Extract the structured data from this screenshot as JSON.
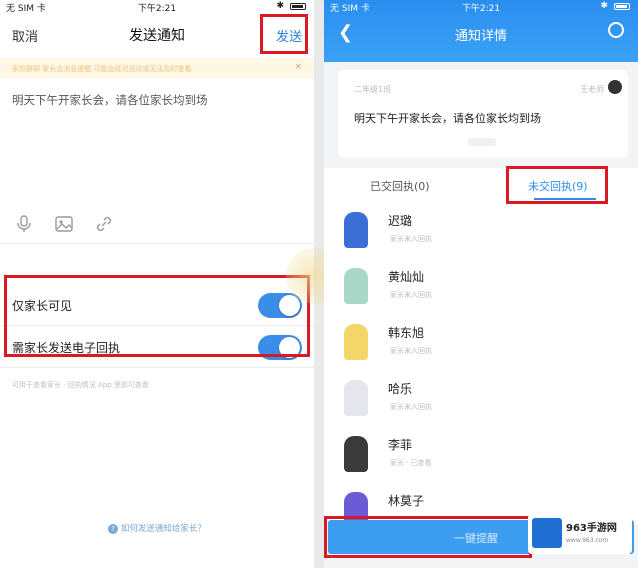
{
  "left": {
    "status": {
      "carrier": "无 SIM 卡",
      "time": "下午2:21"
    },
    "nav": {
      "cancel": "取消",
      "title": "发送通知",
      "send": "发送"
    },
    "tip": "家校群聊 家长会消息提醒 可能会延迟送达或无法及时查看",
    "message": "明天下午开家长会，请各位家长均到场",
    "attachments": [
      "mic-icon",
      "image-icon",
      "link-icon"
    ],
    "toggles": [
      {
        "label": "仅家长可见",
        "on": true
      },
      {
        "label": "需家长发送电子回执",
        "on": true
      }
    ],
    "footer_tip": "可用于查看家长 · 回执情况 App 里即可查看",
    "help_link": "如何发送通知给家长？"
  },
  "right": {
    "status": {
      "carrier": "无 SIM 卡",
      "time": "下午2:21"
    },
    "nav": {
      "title": "通知详情"
    },
    "card": {
      "class": "二年级1班",
      "teacher": "王老师",
      "message": "明天下午开家长会，请各位家长均到场"
    },
    "tabs": {
      "done": "已交回执(0)",
      "pending": "未交回执(9)"
    },
    "students": [
      {
        "name": "迟璐",
        "sub": "家长未入回执",
        "color": "#3c6fd6"
      },
      {
        "name": "黄灿灿",
        "sub": "家长未入回执",
        "color": "#a9d8c8"
      },
      {
        "name": "韩东旭",
        "sub": "家长未入回执",
        "color": "#f2d66a"
      },
      {
        "name": "哈乐",
        "sub": "家长未入回执",
        "color": "#e6e6ee"
      },
      {
        "name": "李菲",
        "sub": "家长 · 已查看",
        "color": "#3a3a3a"
      },
      {
        "name": "林莫子",
        "sub": "",
        "color": "#6b5bd6"
      }
    ],
    "button": "一键提醒",
    "watermark": {
      "title": "963手游网",
      "url": "www.963.com"
    }
  }
}
